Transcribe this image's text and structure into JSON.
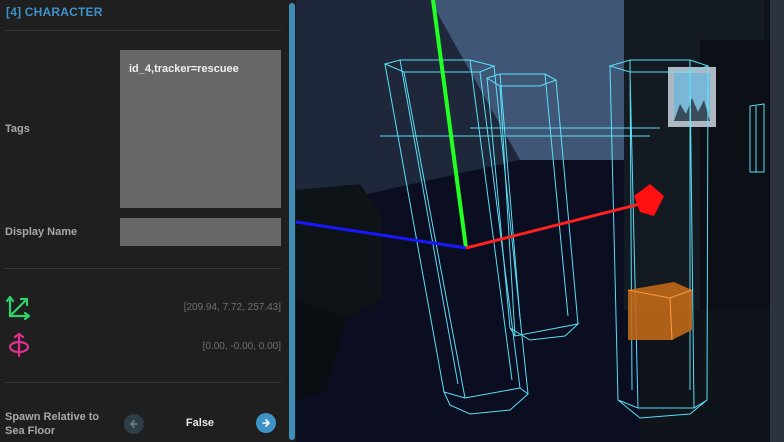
{
  "panel": {
    "header": "[4] CHARACTER",
    "tags_label": "Tags",
    "tags_value": "id_4,tracker=rescuee",
    "display_name_label": "Display Name",
    "display_name_value": "",
    "position_icon": "move-axes-icon",
    "position_value": "[209.94, 7.72, 257.43]",
    "rotation_icon": "rotate-icon",
    "rotation_value": "[0.00, -0.00, 0.00]",
    "spawn_label_line1": "Spawn Relative to",
    "spawn_label_line2": "Sea Floor",
    "spawn_value": "False",
    "prev_icon": "arrow-left-icon",
    "next_icon": "arrow-right-icon"
  },
  "colors": {
    "accent": "#3d93c8",
    "position_icon": "#2fd36a",
    "rotation_icon": "#e0308f",
    "gizmo_x": "#ff2020",
    "gizmo_y": "#22ff22",
    "gizmo_z": "#1818ff",
    "wireframe": "#5fe8ff"
  }
}
